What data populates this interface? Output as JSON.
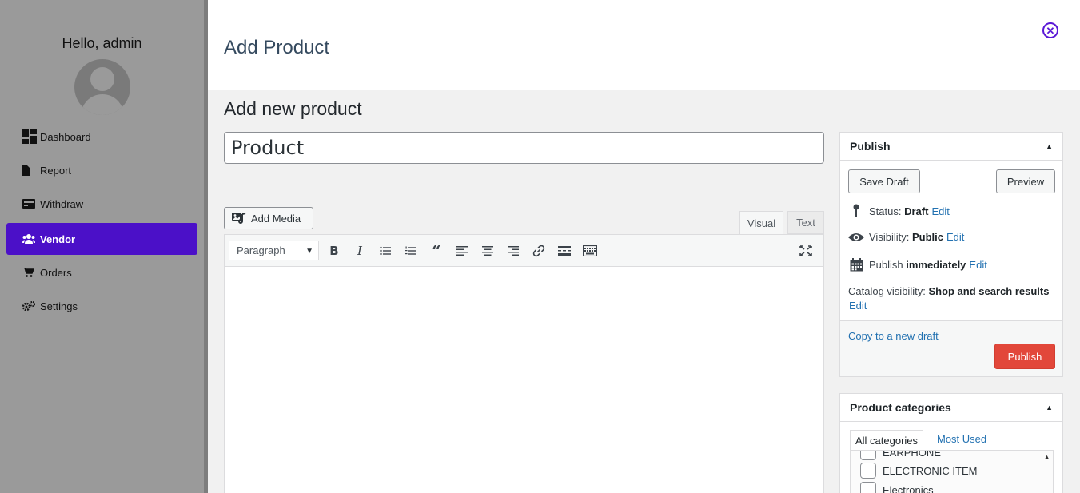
{
  "sidebar": {
    "greeting": "Hello, admin",
    "items": [
      {
        "label": "Dashboard",
        "icon": "dashboard-icon"
      },
      {
        "label": "Report",
        "icon": "file-icon"
      },
      {
        "label": "Withdraw",
        "icon": "money-card-icon"
      },
      {
        "label": "Vendor",
        "icon": "users-icon",
        "active": true
      },
      {
        "label": "Orders",
        "icon": "cart-icon"
      },
      {
        "label": "Settings",
        "icon": "gears-icon"
      }
    ],
    "active_color": "#4b10c8"
  },
  "header": {
    "title": "Add Product",
    "close_icon": "close-circle-icon"
  },
  "main": {
    "heading": "Add new product",
    "title_value": "Product",
    "add_media_label": "Add Media",
    "tabs": {
      "visual": "Visual",
      "text": "Text"
    },
    "format_select": "Paragraph",
    "toolbar_icons": [
      "bold-icon",
      "italic-icon",
      "bullet-list-icon",
      "numbered-list-icon",
      "blockquote-icon",
      "align-left-icon",
      "align-center-icon",
      "align-right-icon",
      "link-icon",
      "read-more-icon",
      "toolbar-toggle-icon",
      "fullscreen-icon"
    ]
  },
  "publish": {
    "title": "Publish",
    "save_draft": "Save Draft",
    "preview": "Preview",
    "status_label": "Status:",
    "status_value": "Draft",
    "visibility_label": "Visibility:",
    "visibility_value": "Public",
    "publish_label": "Publish",
    "publish_value": "immediately",
    "edit": "Edit",
    "catalog_label": "Catalog visibility:",
    "catalog_value": "Shop and search results",
    "copy_link": "Copy to a new draft",
    "publish_button": "Publish",
    "publish_color": "#e2473a"
  },
  "categories": {
    "title": "Product categories",
    "tab_all": "All categories",
    "tab_used": "Most Used",
    "items": [
      "EARPHONE",
      "ELECTRONIC ITEM",
      "Electronics"
    ]
  }
}
